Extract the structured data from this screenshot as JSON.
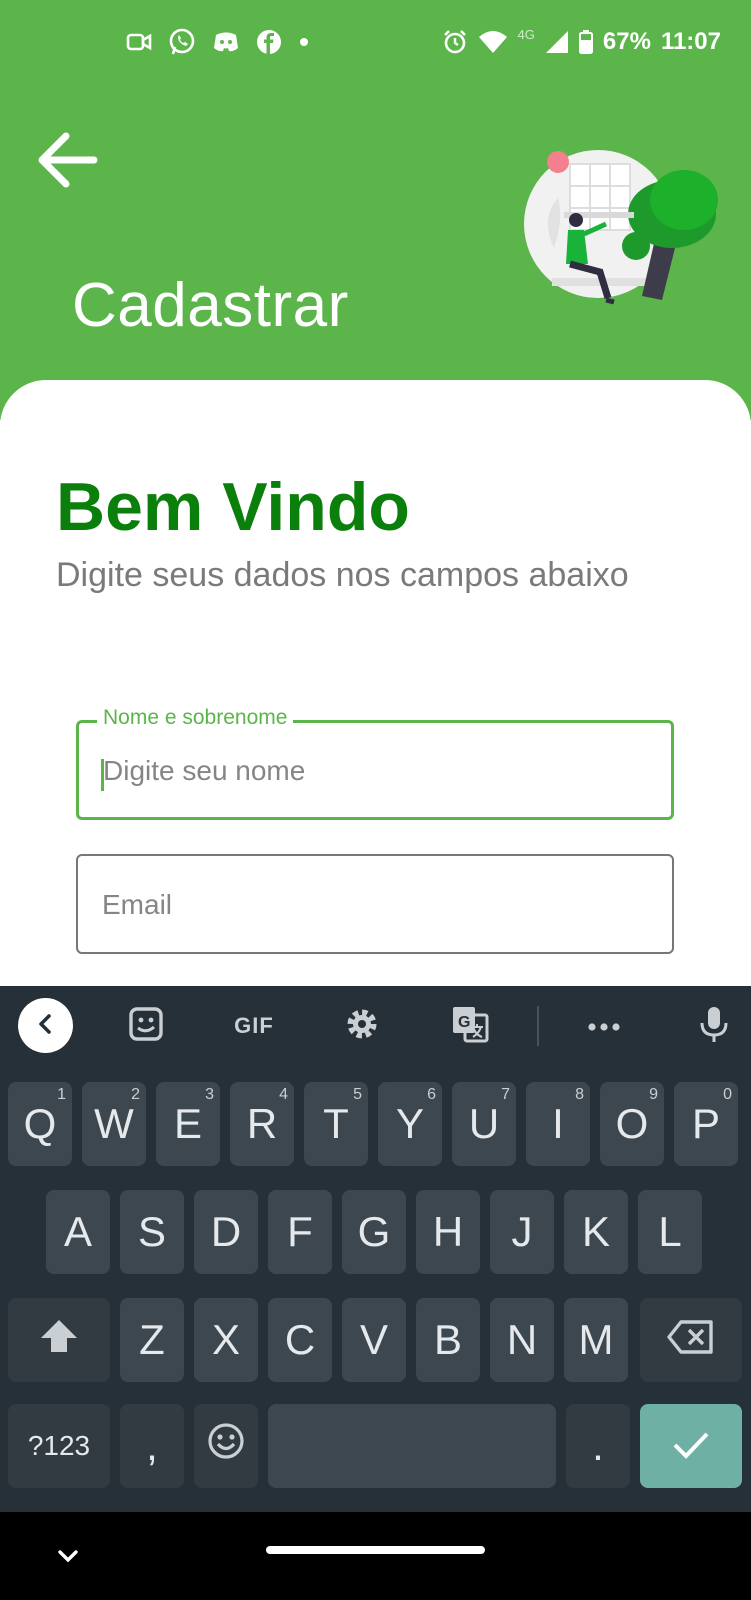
{
  "status_bar": {
    "battery": "67%",
    "time": "11:07",
    "network": "4G",
    "left_icons": [
      "video-call-icon",
      "whatsapp-icon",
      "discord-icon",
      "facebook-icon",
      "dot-icon"
    ],
    "right_icons": [
      "alarm-icon",
      "wifi-icon",
      "signal-icon",
      "battery-icon"
    ]
  },
  "header": {
    "title": "Cadastrar",
    "background_color": "#5cb54b"
  },
  "card": {
    "welcome_title": "Bem Vindo",
    "subtitle": "Digite seus dados nos campos abaixo",
    "accent_color": "#0b7f0b"
  },
  "form": {
    "name_label": "Nome e sobrenome",
    "name_placeholder": "Digite seu nome",
    "name_value": "",
    "email_placeholder": "Email",
    "email_value": ""
  },
  "keyboard": {
    "toolbar": [
      "back-icon",
      "sticker-icon",
      "GIF",
      "settings-icon",
      "translate-icon",
      "more-icon",
      "mic-icon"
    ],
    "row1": [
      {
        "key": "Q",
        "hint": "1"
      },
      {
        "key": "W",
        "hint": "2"
      },
      {
        "key": "E",
        "hint": "3"
      },
      {
        "key": "R",
        "hint": "4"
      },
      {
        "key": "T",
        "hint": "5"
      },
      {
        "key": "Y",
        "hint": "6"
      },
      {
        "key": "U",
        "hint": "7"
      },
      {
        "key": "I",
        "hint": "8"
      },
      {
        "key": "O",
        "hint": "9"
      },
      {
        "key": "P",
        "hint": "0"
      }
    ],
    "row2": [
      "A",
      "S",
      "D",
      "F",
      "G",
      "H",
      "J",
      "K",
      "L"
    ],
    "row3": [
      "Z",
      "X",
      "C",
      "V",
      "B",
      "N",
      "M"
    ],
    "symbols_key": "?123",
    "comma_key": ",",
    "period_key": ".",
    "enter_color": "#6fb0a4"
  }
}
